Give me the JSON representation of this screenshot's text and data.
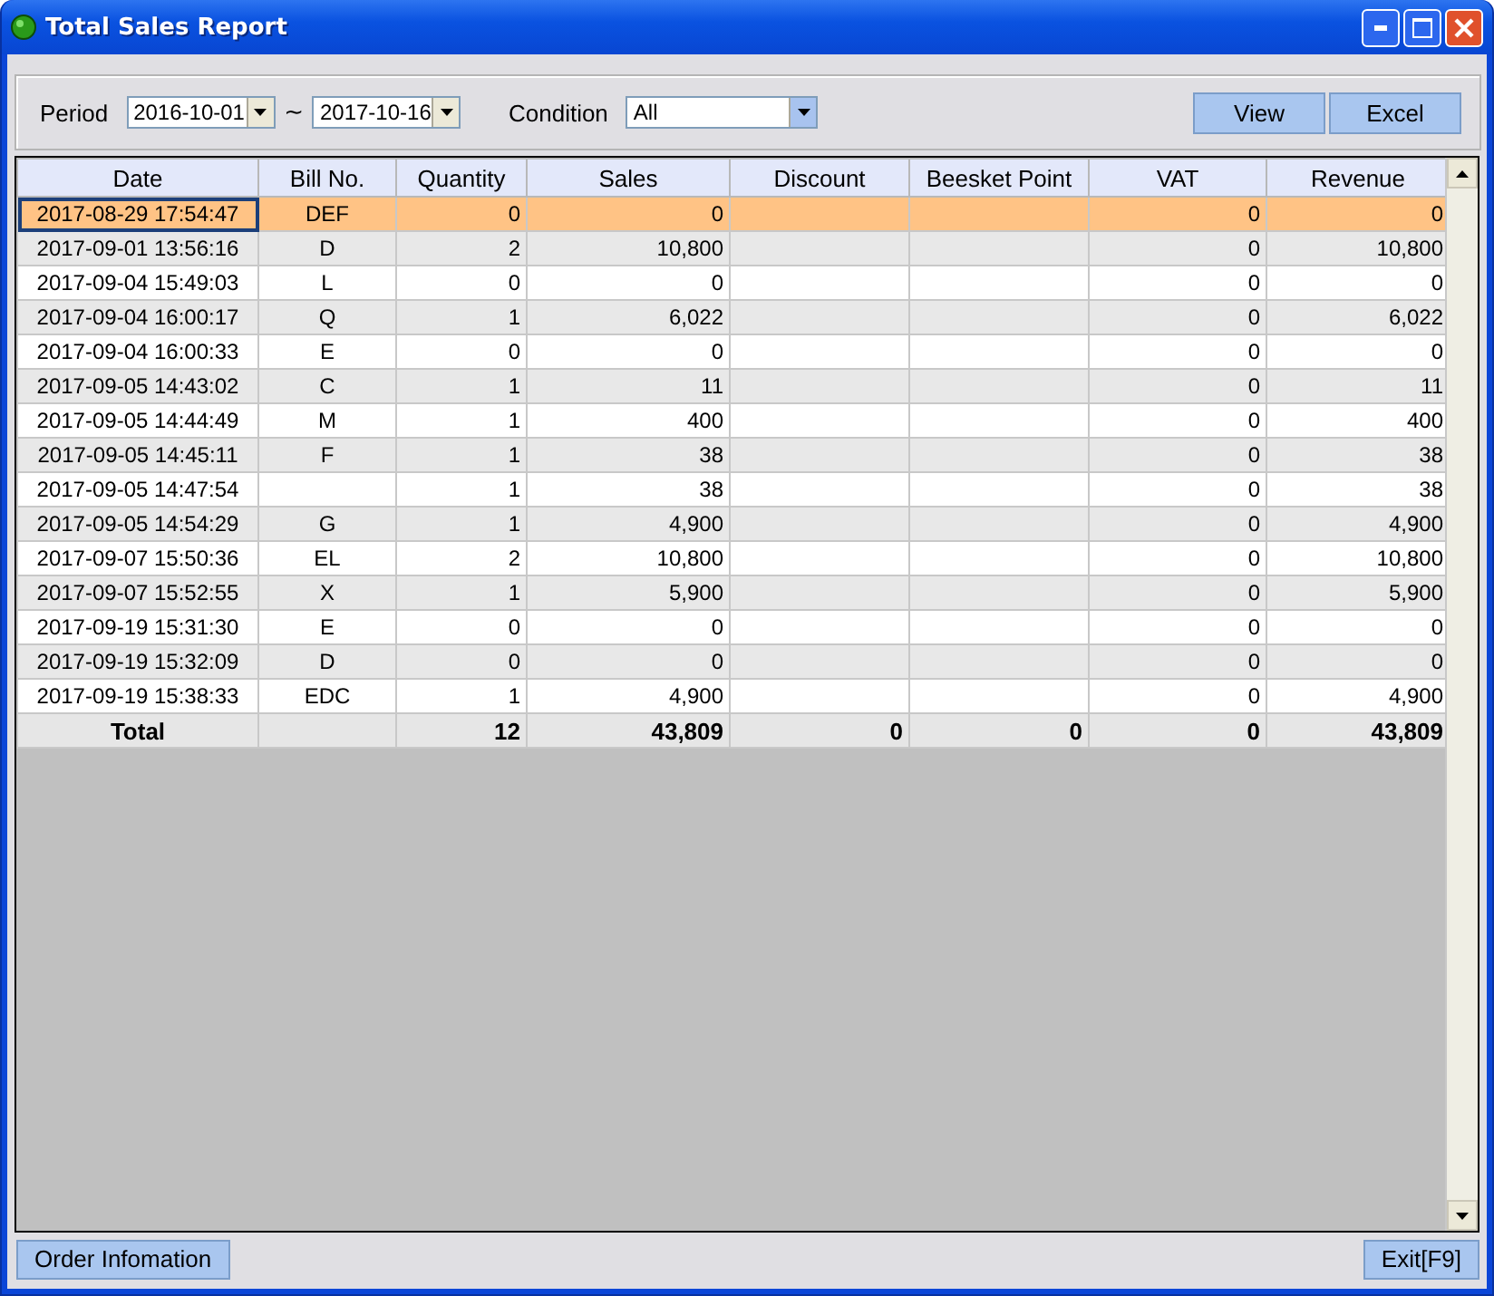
{
  "window": {
    "title": "Total Sales Report"
  },
  "filter": {
    "period_label": "Period",
    "from": "2016-10-01",
    "separator": "~",
    "to": "2017-10-16",
    "condition_label": "Condition",
    "condition": "All",
    "buttons": [
      "View",
      "Excel"
    ]
  },
  "table": {
    "columns": [
      "Date",
      "Bill No.",
      "Quantity",
      "Sales",
      "Discount",
      "Beesket Point",
      "VAT",
      "Revenue"
    ],
    "rows": [
      {
        "selected": true,
        "date": "2017-08-29 17:54:47",
        "bill_no": "DEF",
        "quantity": "0",
        "sales": "0",
        "vat": "0",
        "revenue": "0"
      },
      {
        "selected": false,
        "date": "2017-09-01 13:56:16",
        "bill_no": "D",
        "quantity": "2",
        "sales": "10,800",
        "vat": "0",
        "revenue": "10,800"
      },
      {
        "selected": false,
        "date": "2017-09-04 15:49:03",
        "bill_no": "L",
        "quantity": "0",
        "sales": "0",
        "vat": "0",
        "revenue": "0"
      },
      {
        "selected": false,
        "date": "2017-09-04 16:00:17",
        "bill_no": "Q",
        "quantity": "1",
        "sales": "6,022",
        "vat": "0",
        "revenue": "6,022"
      },
      {
        "selected": false,
        "date": "2017-09-04 16:00:33",
        "bill_no": "E",
        "quantity": "0",
        "sales": "0",
        "vat": "0",
        "revenue": "0"
      },
      {
        "selected": false,
        "date": "2017-09-05 14:43:02",
        "bill_no": "C",
        "quantity": "1",
        "sales": "11",
        "vat": "0",
        "revenue": "11"
      },
      {
        "selected": false,
        "date": "2017-09-05 14:44:49",
        "bill_no": "M",
        "quantity": "1",
        "sales": "400",
        "vat": "0",
        "revenue": "400"
      },
      {
        "selected": false,
        "date": "2017-09-05 14:45:11",
        "bill_no": "F",
        "quantity": "1",
        "sales": "38",
        "vat": "0",
        "revenue": "38"
      },
      {
        "selected": false,
        "date": "2017-09-05 14:47:54",
        "quantity": "1",
        "sales": "38",
        "vat": "0",
        "revenue": "38"
      },
      {
        "selected": false,
        "date": "2017-09-05 14:54:29",
        "bill_no": "G",
        "quantity": "1",
        "sales": "4,900",
        "vat": "0",
        "revenue": "4,900"
      },
      {
        "selected": false,
        "date": "2017-09-07 15:50:36",
        "bill_no": "EL",
        "quantity": "2",
        "sales": "10,800",
        "vat": "0",
        "revenue": "10,800"
      },
      {
        "selected": false,
        "date": "2017-09-07 15:52:55",
        "bill_no": "X",
        "quantity": "1",
        "sales": "5,900",
        "vat": "0",
        "revenue": "5,900"
      },
      {
        "selected": false,
        "date": "2017-09-19 15:31:30",
        "bill_no": "E",
        "quantity": "0",
        "sales": "0",
        "vat": "0",
        "revenue": "0"
      },
      {
        "selected": false,
        "date": "2017-09-19 15:32:09",
        "bill_no": "D",
        "quantity": "0",
        "sales": "0",
        "vat": "0",
        "revenue": "0"
      },
      {
        "selected": false,
        "date": "2017-09-19 15:38:33",
        "bill_no": "EDC",
        "quantity": "1",
        "sales": "4,900",
        "vat": "0",
        "revenue": "4,900"
      }
    ],
    "total": {
      "label": "Total",
      "quantity": "12",
      "sales": "43,809",
      "discount": "0",
      "beesket_point": "0",
      "vat": "0",
      "revenue": "43,809"
    }
  },
  "footer": {
    "left_button": "Order Infomation",
    "right_button": "Exit[F9]"
  }
}
